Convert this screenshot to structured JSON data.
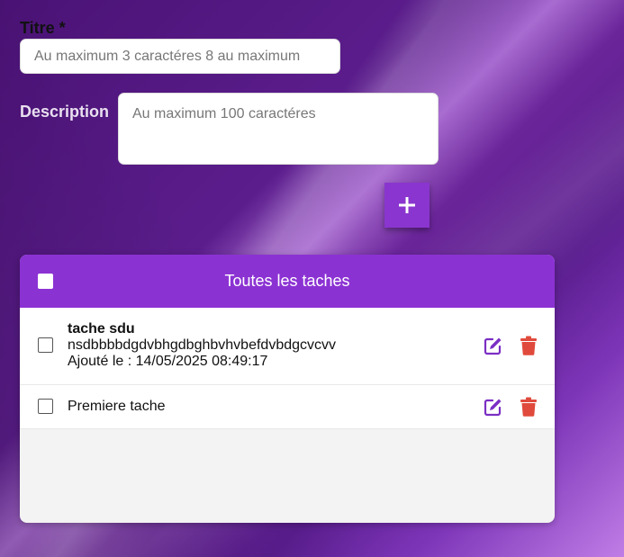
{
  "form": {
    "title_label": "Titre *",
    "title_placeholder": "Au maximum 3 caractéres 8 au maximum",
    "title_value": "",
    "description_label": "Description",
    "description_placeholder": "Au maximum 100 caractéres",
    "description_value": "",
    "add_button_icon": "plus-icon"
  },
  "task_list": {
    "header_title": "Toutes les taches",
    "select_all_checked": false,
    "tasks": [
      {
        "title": "tache sdu",
        "description": "nsdbbbbdgdvbhgdbghbvhvbefdvbdgcvcvv",
        "added_at": "Ajouté le : 14/05/2025 08:49:17",
        "checked": false,
        "edit_icon": "edit-icon",
        "delete_icon": "trash-icon"
      },
      {
        "title": "Premiere tache",
        "checked": false,
        "edit_icon": "edit-icon",
        "delete_icon": "trash-icon"
      }
    ]
  },
  "colors": {
    "accent": "#8b32d3",
    "edit_icon": "#7b2fc4",
    "delete_icon": "#e04a3c"
  }
}
